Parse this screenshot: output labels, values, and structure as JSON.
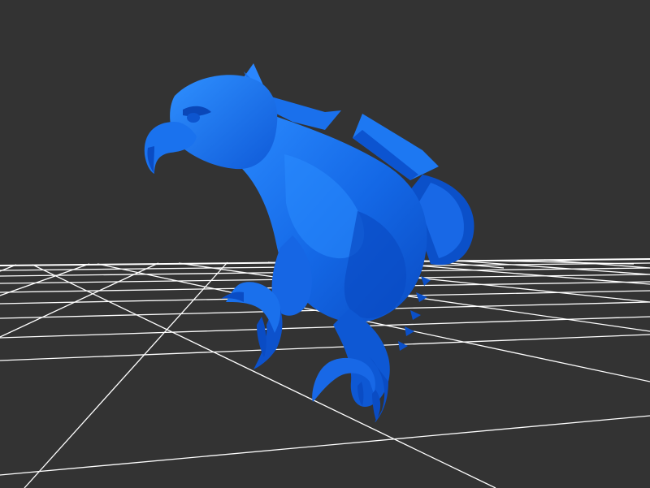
{
  "viewer": {
    "background_color": "#333333",
    "grid_color": "#ffffff",
    "model": {
      "name": "eagle",
      "color": "#1060e0",
      "color_light": "#2a86ff",
      "color_dark": "#0848b8"
    },
    "icons": [
      "grid-floor",
      "eagle-mesh"
    ]
  }
}
